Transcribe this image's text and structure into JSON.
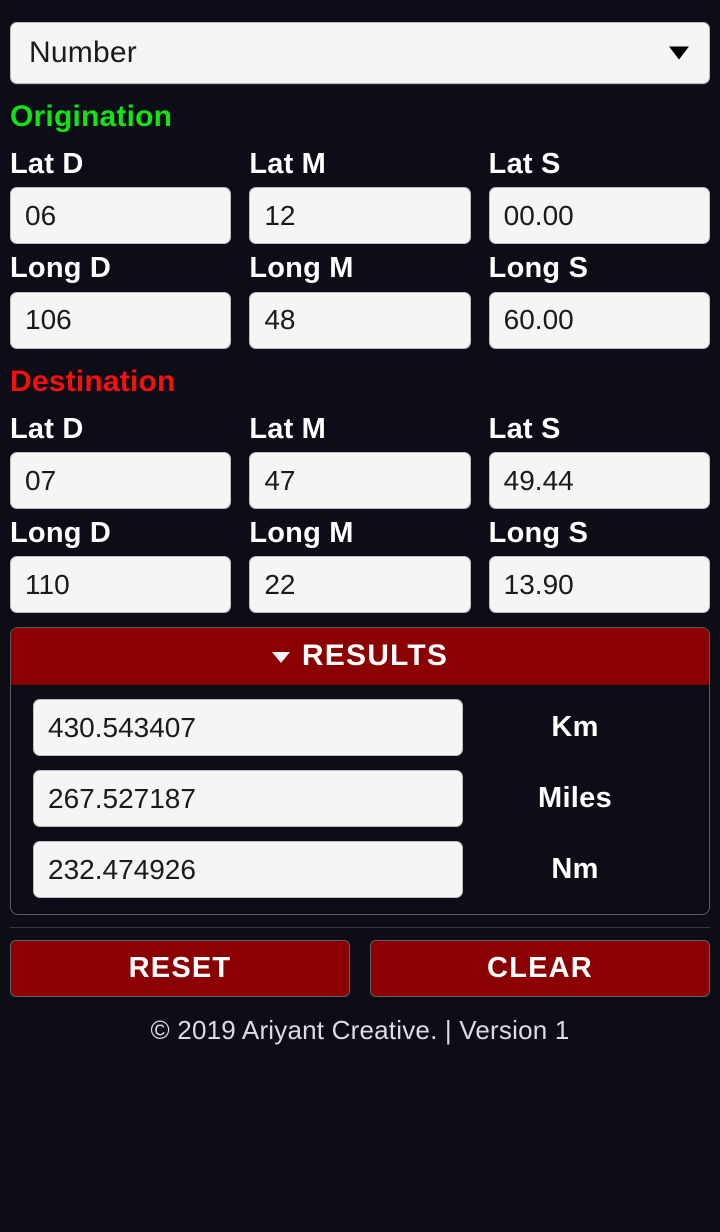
{
  "selector": {
    "name": "input-format-select",
    "value": "Number",
    "caret_icon": "triangle-down-icon",
    "options": [
      "Number"
    ]
  },
  "origination": {
    "heading": "Origination",
    "heading_color": "#14e214",
    "lat": {
      "labels": [
        "Lat D",
        "Lat M",
        "Lat S"
      ],
      "values": [
        "06",
        "12",
        "00.00"
      ]
    },
    "long": {
      "labels": [
        "Long D",
        "Long M",
        "Long S"
      ],
      "values": [
        "106",
        "48",
        "60.00"
      ]
    }
  },
  "destination": {
    "heading": "Destination",
    "heading_color": "#f70f0f",
    "lat": {
      "labels": [
        "Lat D",
        "Lat M",
        "Lat S"
      ],
      "values": [
        "07",
        "47",
        "49.44"
      ]
    },
    "long": {
      "labels": [
        "Long D",
        "Long M",
        "Long S"
      ],
      "values": [
        "110",
        "22",
        "13.90"
      ]
    }
  },
  "results": {
    "title": "RESULTS",
    "caret_icon": "triangle-down-icon",
    "header_color": "#8b0000",
    "rows": [
      {
        "value": "430.543407",
        "unit": "Km"
      },
      {
        "value": "267.527187",
        "unit": "Miles"
      },
      {
        "value": "232.474926",
        "unit": "Nm"
      }
    ]
  },
  "actions": {
    "reset_label": "RESET",
    "clear_label": "CLEAR",
    "button_color": "#8b0000"
  },
  "footer": {
    "text": "© 2019 Ariyant Creative. | Version 1"
  }
}
